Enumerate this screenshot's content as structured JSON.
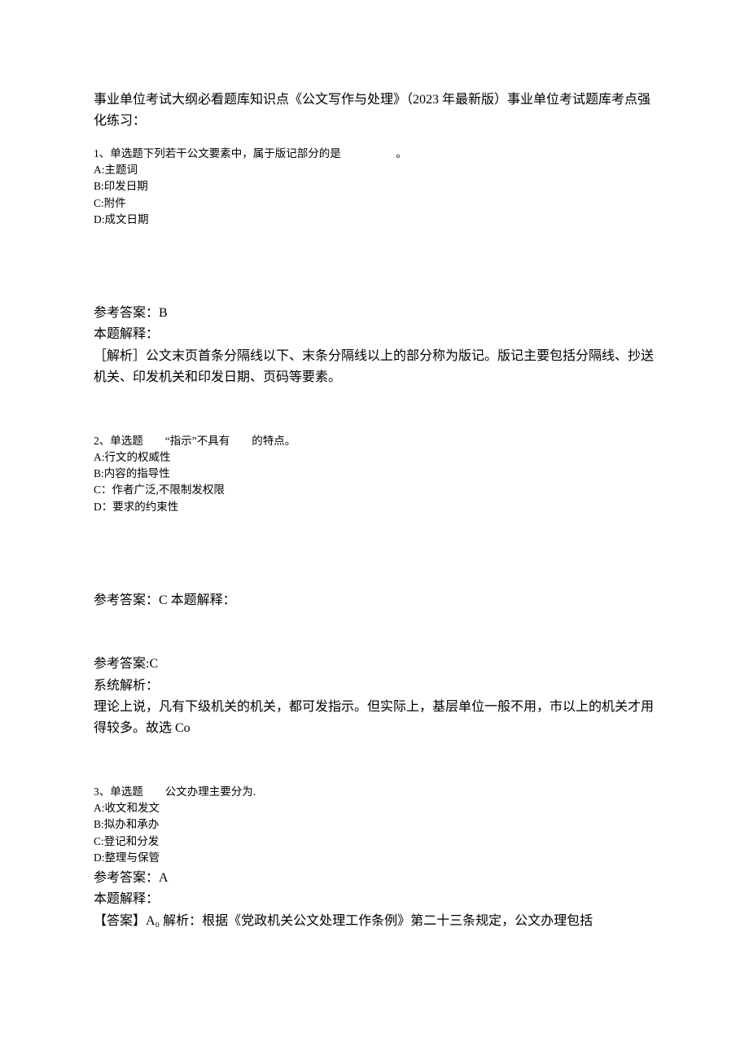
{
  "intro": "事业单位考试大纲必看题库知识点《公文写作与处理》（2023 年最新版）事业单位考试题库考点强化练习：",
  "q1": {
    "stem": "1、单选题下列若干公文要素中，属于版记部分的是　　　　　。",
    "optA": "A:主题词",
    "optB": "B:印发日期",
    "optC": "C:附件",
    "optD": "D:成文日期",
    "answer": "参考答案：B",
    "explainLabel": "本题解释：",
    "explainBody": "［解析］公文末页首条分隔线以下、末条分隔线以上的部分称为版记。版记主要包括分隔线、抄送机关、印发机关和印发日期、页码等要素。"
  },
  "q2": {
    "stem": "2、单选题　　“指示”不具有　　的特点。",
    "optA": "A:行文的权威性",
    "optB": "B:内容的指导性",
    "optC": "C：作者广泛,不限制发权限",
    "optD": "D：要求的约束性",
    "answer": "参考答案：C 本题解释：",
    "answer2": "参考答案:C",
    "explainLabel": "系统解析：",
    "explainBody": "理论上说，凡有下级机关的机关，都可发指示。但实际上，基层单位一般不用，市以上的机关才用得较多。故选 Co"
  },
  "q3": {
    "stem": "3、单选题　　公文办理主要分为.",
    "optA": "A:收文和发文",
    "optB": "B:拟办和承办",
    "optC": "C:登记和分发",
    "optD": "D:整理与保管",
    "answer": "参考答案：A",
    "explainLabel": "本题解释：",
    "explainBody": "【答案】A₀ 解析：根据《党政机关公文处理工作条例》第二十三条规定，公文办理包括"
  }
}
